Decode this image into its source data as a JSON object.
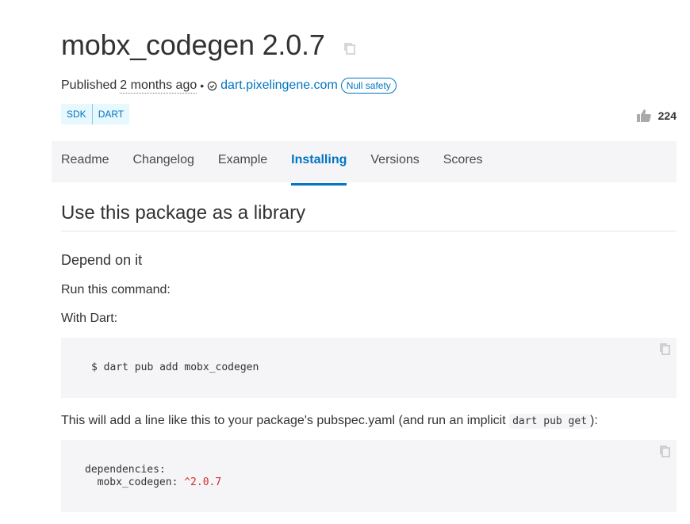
{
  "package": {
    "title": "mobx_codegen 2.0.7",
    "published_prefix": "Published",
    "published_ago": "2 months ago",
    "separator": "•",
    "publisher": "dart.pixelingene.com",
    "badge": "Null safety",
    "tags": [
      "SDK",
      "DART"
    ],
    "likes": "224"
  },
  "tabs": [
    {
      "label": "Readme",
      "active": false
    },
    {
      "label": "Changelog",
      "active": false
    },
    {
      "label": "Example",
      "active": false
    },
    {
      "label": "Installing",
      "active": true
    },
    {
      "label": "Versions",
      "active": false
    },
    {
      "label": "Scores",
      "active": false
    }
  ],
  "content": {
    "heading": "Use this package as a library",
    "subheading": "Depend on it",
    "run_command": "Run this command:",
    "with_dart": "With Dart:",
    "command": "$ dart pub add mobx_codegen",
    "add_line_prefix": "This will add a line like this to your package's pubspec.yaml (and run an implicit",
    "add_line_code": "dart pub get",
    "add_line_suffix": "):",
    "deps_key": "dependencies:",
    "dep_name": "mobx_codegen:",
    "dep_version": "^2.0.7"
  },
  "icons": {
    "copy": "copy-icon",
    "like": "thumb-up-icon",
    "verified": "verified-publisher-icon"
  },
  "colors": {
    "accent": "#0175c2",
    "tab_bg": "#f5f5f7",
    "code_bg": "#f5f5f7",
    "version": "#d32f2f"
  }
}
